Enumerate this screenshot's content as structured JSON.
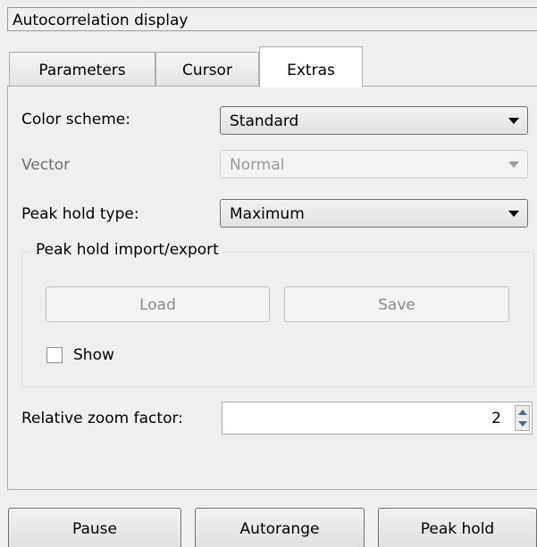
{
  "window": {
    "title": "Autocorrelation display"
  },
  "tabs": [
    {
      "label": "Parameters",
      "active": false
    },
    {
      "label": "Cursor",
      "active": false
    },
    {
      "label": "Extras",
      "active": true
    }
  ],
  "extras": {
    "color_scheme": {
      "label": "Color scheme:",
      "value": "Standard"
    },
    "vector": {
      "label": "Vector",
      "value": "Normal",
      "disabled": true
    },
    "peak_hold_type": {
      "label": "Peak hold type:",
      "value": "Maximum"
    },
    "peak_hold_io": {
      "title": "Peak hold import/export",
      "load_label": "Load",
      "save_label": "Save",
      "show_label": "Show",
      "show_checked": false
    },
    "zoom": {
      "label": "Relative zoom factor:",
      "value": "2"
    }
  },
  "bottom_buttons": {
    "pause": "Pause",
    "autorange": "Autorange",
    "peak_hold": "Peak hold"
  },
  "colors": {
    "background": "#f0f0f0",
    "border": "#adadad",
    "disabled_text": "#8c8c8c",
    "spin_arrow": "#4a6b8d"
  }
}
